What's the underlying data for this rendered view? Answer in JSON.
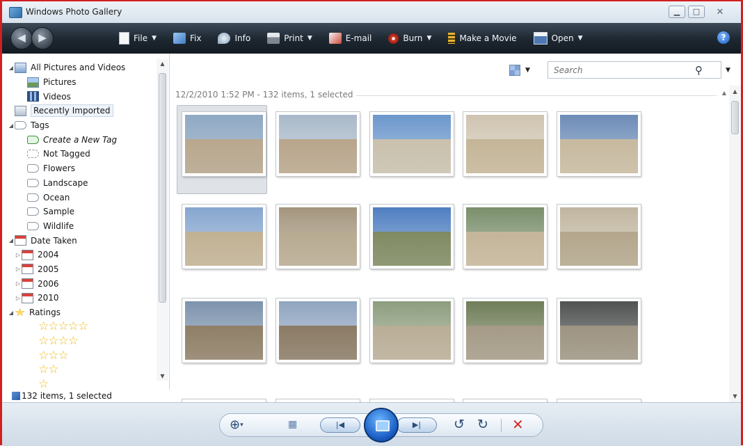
{
  "window": {
    "title": "Windows Photo Gallery",
    "controls": [
      "minimize-icon",
      "maximize-icon",
      "close-icon"
    ]
  },
  "toolbar": {
    "items": [
      {
        "label": "File",
        "icon": "file-icon",
        "has_menu": true
      },
      {
        "label": "Fix",
        "icon": "fix-icon",
        "has_menu": false
      },
      {
        "label": "Info",
        "icon": "info-icon",
        "has_menu": false
      },
      {
        "label": "Print",
        "icon": "printer-icon",
        "has_menu": true
      },
      {
        "label": "E-mail",
        "icon": "email-icon",
        "has_menu": false
      },
      {
        "label": "Burn",
        "icon": "burn-disc-icon",
        "has_menu": true
      },
      {
        "label": "Make a Movie",
        "icon": "film-icon",
        "has_menu": false
      },
      {
        "label": "Open",
        "icon": "open-icon",
        "has_menu": true
      }
    ],
    "help_label": "?"
  },
  "nav": {
    "items": [
      {
        "label": "All Pictures and Videos",
        "level": 0,
        "expanded": true,
        "icon": "pictures-folder-icon"
      },
      {
        "label": "Pictures",
        "level": 1,
        "icon": "picture-icon"
      },
      {
        "label": "Videos",
        "level": 1,
        "icon": "video-icon"
      },
      {
        "label": "Recently Imported",
        "level": 0,
        "selected": true,
        "icon": "recently-imported-icon"
      },
      {
        "label": "Tags",
        "level": 0,
        "expanded": true,
        "icon": "tag-icon"
      },
      {
        "label": "Create a New Tag",
        "level": 1,
        "italic": true,
        "icon": "new-tag-icon"
      },
      {
        "label": "Not Tagged",
        "level": 1,
        "icon": "untagged-icon"
      },
      {
        "label": "Flowers",
        "level": 1,
        "icon": "tag-icon"
      },
      {
        "label": "Landscape",
        "level": 1,
        "icon": "tag-icon"
      },
      {
        "label": "Ocean",
        "level": 1,
        "icon": "tag-icon"
      },
      {
        "label": "Sample",
        "level": 1,
        "icon": "tag-icon"
      },
      {
        "label": "Wildlife",
        "level": 1,
        "icon": "tag-icon"
      },
      {
        "label": "Date Taken",
        "level": 0,
        "expanded": true,
        "icon": "calendar-icon"
      },
      {
        "label": "2004",
        "level": 1,
        "collapsed": true,
        "icon": "calendar-icon"
      },
      {
        "label": "2005",
        "level": 1,
        "collapsed": true,
        "icon": "calendar-icon"
      },
      {
        "label": "2006",
        "level": 1,
        "collapsed": true,
        "icon": "calendar-icon"
      },
      {
        "label": "2010",
        "level": 1,
        "collapsed": true,
        "icon": "calendar-icon"
      },
      {
        "label": "Ratings",
        "level": 0,
        "expanded": true,
        "icon": "star-icon"
      }
    ],
    "ratings": [
      5,
      4,
      3,
      2,
      1
    ]
  },
  "status": {
    "text": "132 items, 1 selected"
  },
  "search": {
    "placeholder": "Search"
  },
  "gallery": {
    "group_header": "12/2/2010 1:52 PM - 132 items, 1 selected",
    "thumbnails": [
      {
        "sky": "#8fa9c4",
        "ground": "#b9a88e",
        "selected": true
      },
      {
        "sky": "#a9b9c9",
        "ground": "#b8a58b"
      },
      {
        "sky": "#6c97cc",
        "ground": "#c9c0ad"
      },
      {
        "sky": "#cfc4b0",
        "ground": "#c4b597"
      },
      {
        "sky": "#6d8cb8",
        "ground": "#c7b99f"
      },
      {
        "sky": "#86a6cf",
        "ground": "#c1b193"
      },
      {
        "sky": "#a4957e",
        "ground": "#b7aa91"
      },
      {
        "sky": "#4f7fc1",
        "ground": "#7f8a62"
      },
      {
        "sky": "#7a8f6c",
        "ground": "#c4b599"
      },
      {
        "sky": "#c0b59f",
        "ground": "#b3a68c"
      },
      {
        "sky": "#7d93ad",
        "ground": "#8f7f67"
      },
      {
        "sky": "#90a5c0",
        "ground": "#8b7b66"
      },
      {
        "sky": "#8d9d7e",
        "ground": "#b9ad96"
      },
      {
        "sky": "#6f7d58",
        "ground": "#a49a86"
      },
      {
        "sky": "#4f5250",
        "ground": "#9d9482"
      }
    ]
  }
}
